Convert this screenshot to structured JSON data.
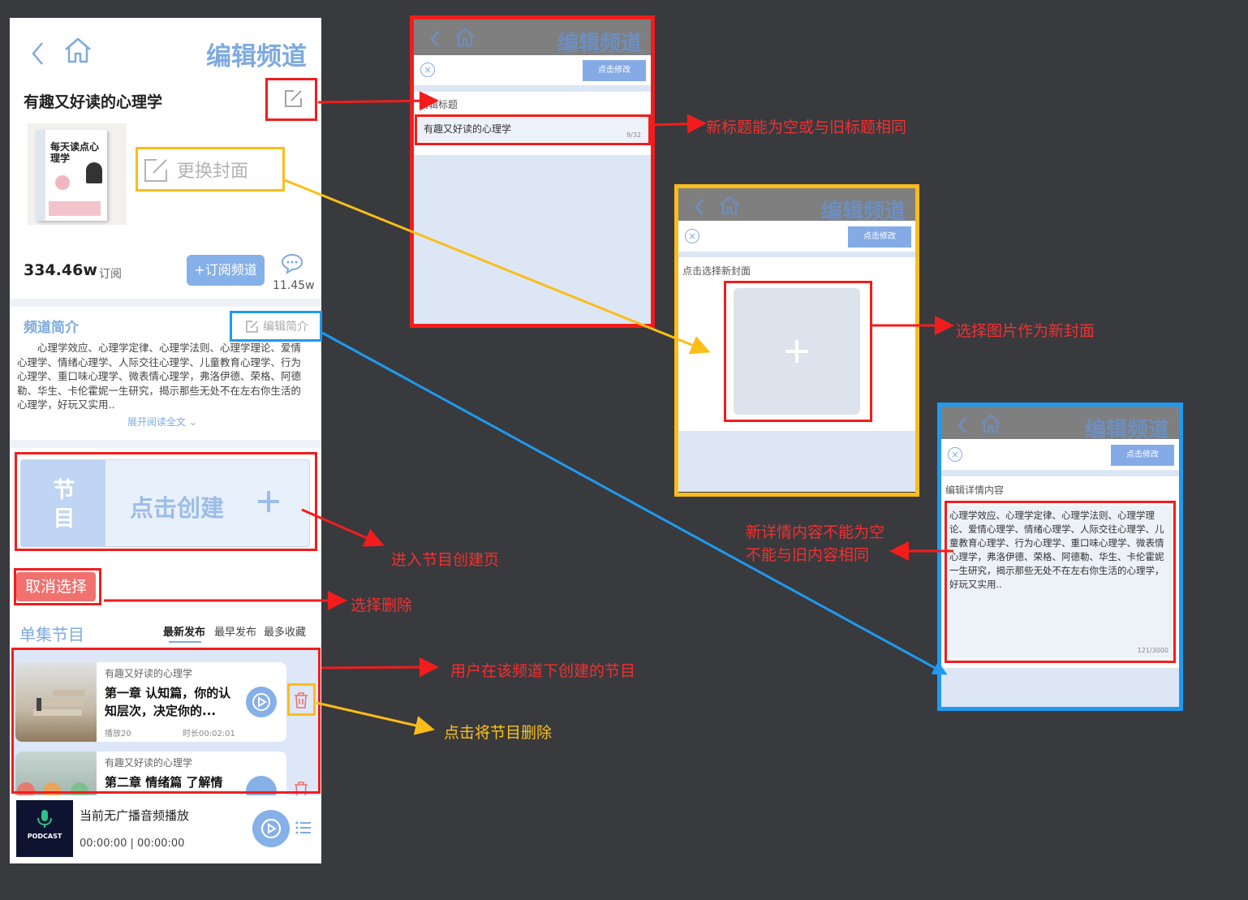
{
  "phone": {
    "header_title": "编辑频道",
    "channel_title": "有趣又好读的心理学",
    "cover_book_title": "每天读点心理学",
    "change_cover": "更换封面",
    "subscribers": "334.46w",
    "subscribe_label": "订阅",
    "subscribe_button": "+订阅频道",
    "comments_count": "11.45w",
    "intro_heading": "频道简介",
    "edit_intro": "编辑简介",
    "intro_text": "心理学效应、心理学定律、心理学法则、心理学理论、爱情心理学、情绪心理学、人际交往心理学、儿童教育心理学、行为心理学、重口味心理学、微表情心理学，弗洛伊德、荣格、阿德勒、华生、卡伦霍妮一生研究，揭示那些无处不在左右你生活的心理学，好玩又实用..",
    "expand_text": "展开阅读全文",
    "create_tag": "节目",
    "create_label": "点击创建",
    "cancel_select": "取消选择",
    "episodes_heading": "单集节目",
    "sort_tabs": [
      "最新发布",
      "最早发布",
      "最多收藏"
    ],
    "episodes": [
      {
        "channel": "有趣又好读的心理学",
        "title": "第一章 认知篇，你的认知层次，决定你的...",
        "plays": "播放20",
        "duration": "时长00:02:01"
      },
      {
        "channel": "有趣又好读的心理学",
        "title": "第二章 情绪篇 了解情",
        "plays": "",
        "duration": ""
      }
    ],
    "player_text": "当前无广播音频播放",
    "player_time": "00:00:00 | 00:00:00",
    "podcast_label": "PODCAST"
  },
  "mini_title_screen": {
    "header_title": "编辑频道",
    "button": "点击修改",
    "field_label": "编辑标题",
    "field_value": "有趣又好读的心理学",
    "counter": "9/32"
  },
  "mini_cover_screen": {
    "header_title": "编辑频道",
    "button": "点击修改",
    "field_label": "点击选择新封面"
  },
  "mini_detail_screen": {
    "header_title": "编辑频道",
    "button": "点击修改",
    "field_label": "编辑详情内容",
    "field_value": "心理学效应、心理学定律、心理学法则、心理学理论、爱情心理学、情绪心理学、人际交往心理学、儿童教育心理学、行为心理学、重口味心理学、微表情心理学，弗洛伊德、荣格、阿德勒、华生、卡伦霍妮一生研究，揭示那些无处不在左右你生活的心理学，好玩又实用..",
    "counter": "121/3000"
  },
  "annotations": {
    "title_rule": "新标题能为空或与旧标题相同",
    "cover_rule": "选择图片作为新封面",
    "detail_rule_1": "新详情内容不能为空",
    "detail_rule_2": "不能与旧内容相同",
    "create_rule": "进入节目创建页",
    "select_delete": "选择删除",
    "user_episodes": "用户在该频道下创建的节目",
    "delete_episode": "点击将节目删除"
  },
  "colors": {
    "background": "#393a3e",
    "accent_blue": "#7eaae0",
    "annotation_red": "#f21d1d",
    "annotation_yellow": "#fbbd1a",
    "annotation_blue": "#1e9af0"
  }
}
